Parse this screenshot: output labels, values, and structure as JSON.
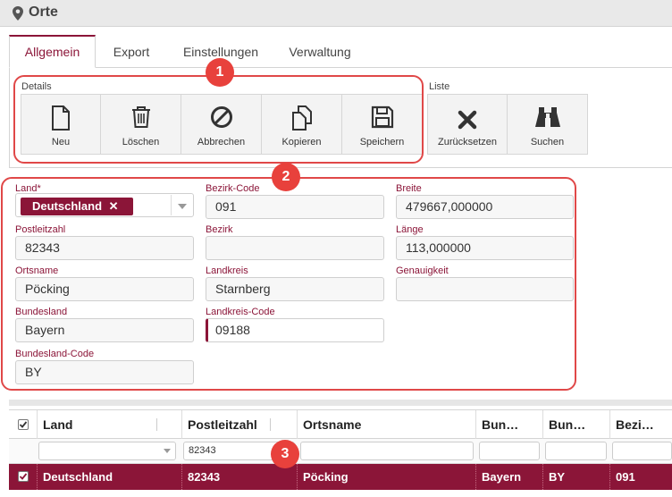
{
  "window": {
    "title": "Orte"
  },
  "tabs": [
    {
      "label": "Allgemein",
      "active": true
    },
    {
      "label": "Export"
    },
    {
      "label": "Einstellungen"
    },
    {
      "label": "Verwaltung"
    }
  ],
  "toolbar": {
    "details_label": "Details",
    "liste_label": "Liste",
    "buttons": [
      {
        "label": "Neu",
        "icon": "new-document-icon"
      },
      {
        "label": "Löschen",
        "icon": "trash-icon"
      },
      {
        "label": "Abbrechen",
        "icon": "cancel-icon"
      },
      {
        "label": "Kopieren",
        "icon": "copy-icon"
      },
      {
        "label": "Speichern",
        "icon": "save-icon"
      },
      {
        "label": "Zurücksetzen",
        "icon": "reset-x-icon"
      },
      {
        "label": "Suchen",
        "icon": "binoculars-icon"
      }
    ]
  },
  "form": {
    "land": {
      "label": "Land",
      "required_mark": "*",
      "value": "Deutschland",
      "remove_glyph": "✕"
    },
    "bezirk_code": {
      "label": "Bezirk-Code",
      "value": "091"
    },
    "breite": {
      "label": "Breite",
      "value": "479667,000000"
    },
    "postleitzahl": {
      "label": "Postleitzahl",
      "value": "82343"
    },
    "bezirk": {
      "label": "Bezirk",
      "value": ""
    },
    "laenge": {
      "label": "Länge",
      "value": "113,000000"
    },
    "ortsname": {
      "label": "Ortsname",
      "value": "Pöcking"
    },
    "landkreis": {
      "label": "Landkreis",
      "value": "Starnberg"
    },
    "genauigkeit": {
      "label": "Genauigkeit",
      "value": ""
    },
    "bundesland": {
      "label": "Bundesland",
      "value": "Bayern"
    },
    "landkreis_code": {
      "label": "Landkreis-Code",
      "value": "09188"
    },
    "bundesland_code": {
      "label": "Bundesland-Code",
      "value": "BY"
    }
  },
  "grid": {
    "columns": [
      "Land",
      "Postleitzahl",
      "Ortsname",
      "Bun…",
      "Bun…",
      "Bezi…"
    ],
    "filters": {
      "postleitzahl": "82343"
    },
    "rows": [
      {
        "land": "Deutschland",
        "postleitzahl": "82343",
        "ortsname": "Pöcking",
        "bundesland": "Bayern",
        "bundesland_code": "BY",
        "bezirk_code": "091",
        "selected": true
      }
    ]
  },
  "callouts": [
    "1",
    "2",
    "3"
  ],
  "colors": {
    "accent": "#8b1538",
    "callout": "#e8413c"
  }
}
